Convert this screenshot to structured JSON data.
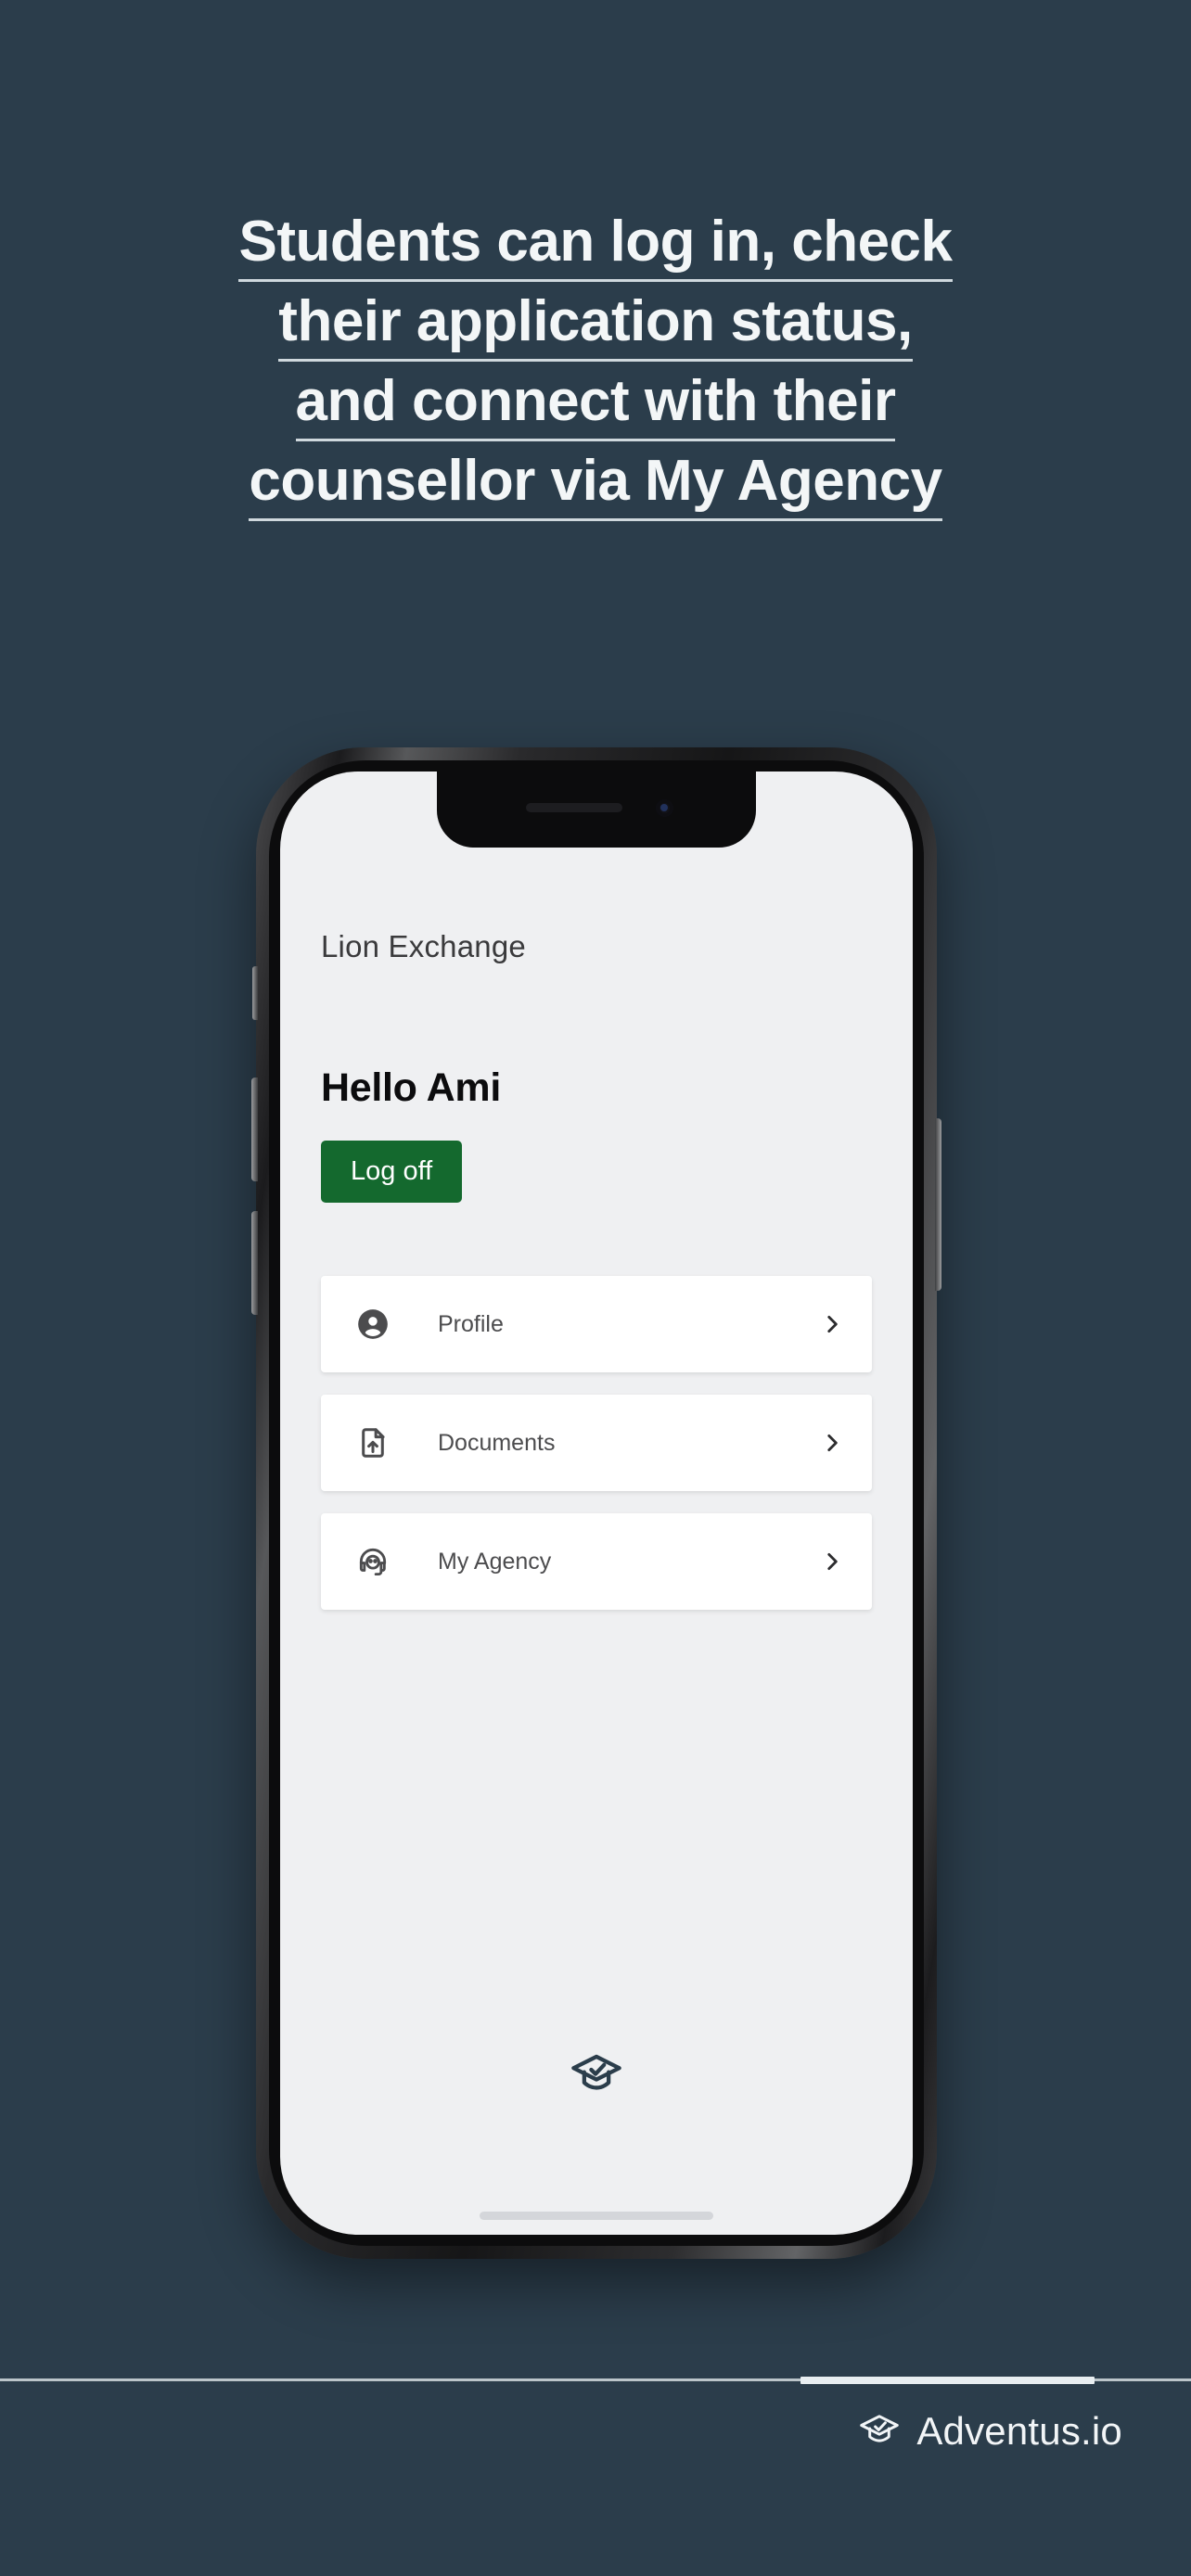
{
  "headline": {
    "lines": [
      "Students can log in, check",
      "their application status,",
      "and connect with their",
      "counsellor via My Agency"
    ],
    "full_text": "Students can log in, check their application status, and connect with their counsellor via My Agency",
    "color": "#f3f6f7"
  },
  "background_color": "#2b3d4b",
  "phone": {
    "screen_background": "#eff0f2",
    "app": {
      "title": "Lion Exchange",
      "greeting": "Hello Ami",
      "logoff_label": "Log off",
      "logoff_color": "#14692e",
      "menu": [
        {
          "label": "Profile",
          "icon": "person-icon",
          "chevron": "chevron-right-icon"
        },
        {
          "label": "Documents",
          "icon": "file-upload-icon",
          "chevron": "chevron-right-icon"
        },
        {
          "label": "My Agency",
          "icon": "support-agent-icon",
          "chevron": "chevron-right-icon"
        }
      ],
      "brand_logo_icon": "graduation-cap-icon"
    }
  },
  "footer": {
    "brand_text": "Adventus.io",
    "brand_icon": "graduation-cap-icon",
    "progress_color": "#e8eef1"
  }
}
